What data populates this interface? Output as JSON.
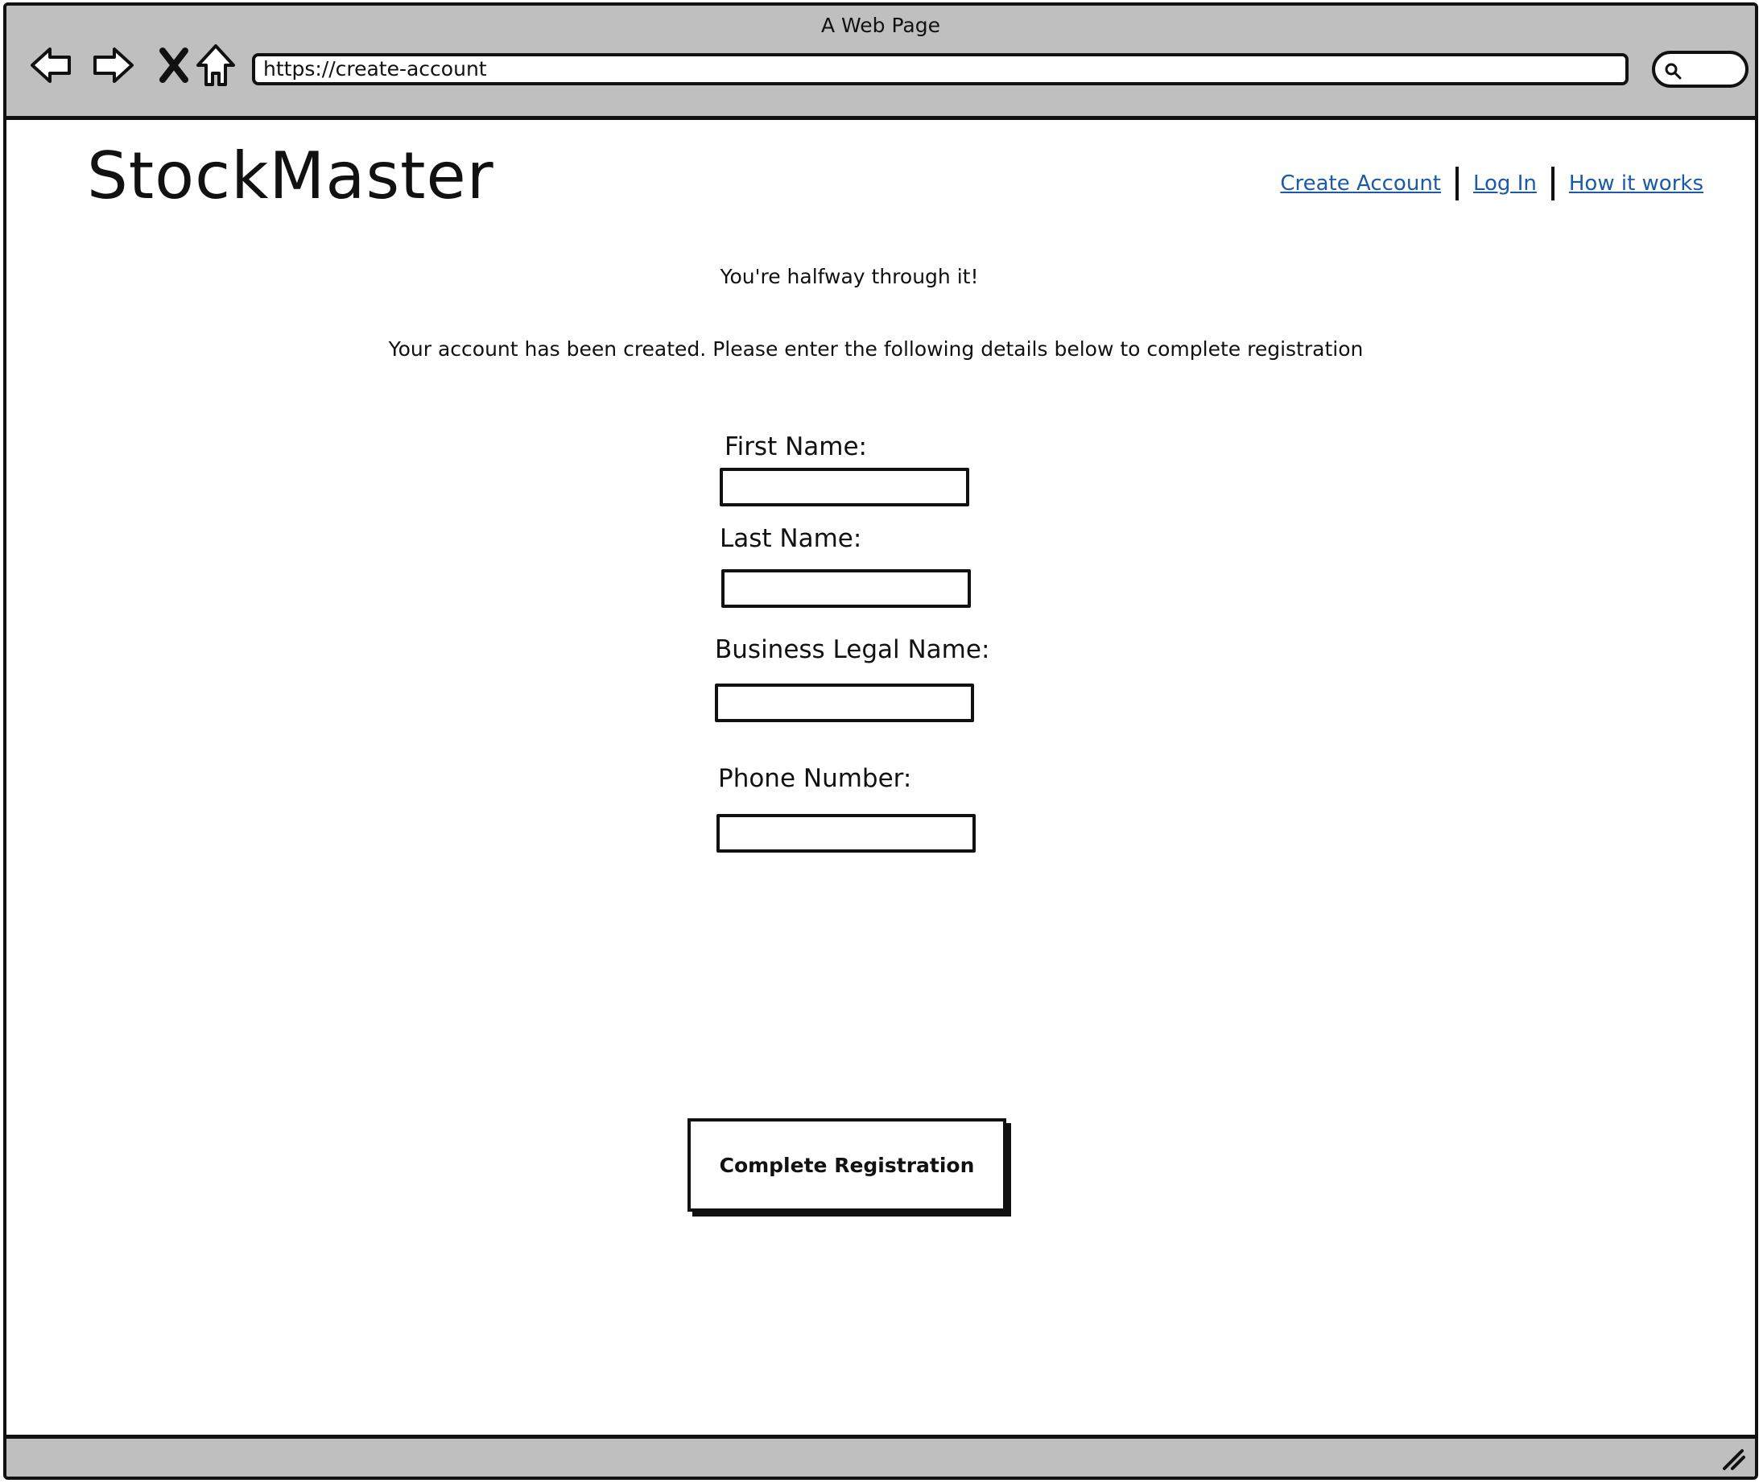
{
  "window": {
    "title": "A Web Page"
  },
  "browser": {
    "url": "https://create-account",
    "icons": [
      "back-arrow-icon",
      "forward-arrow-icon",
      "close-icon",
      "home-icon",
      "search-icon",
      "resize-grip-icon"
    ]
  },
  "header": {
    "logo": "StockMaster",
    "nav": {
      "create_account": "Create Account",
      "log_in": "Log In",
      "how_it_works": "How it works"
    },
    "link_color": "#1a5aa8"
  },
  "main": {
    "subtitle": "You're halfway through it!",
    "message": "Your account has been created. Please enter the following details below to complete registration",
    "fields": {
      "first_name": {
        "label": "First Name:",
        "value": ""
      },
      "last_name": {
        "label": "Last Name:",
        "value": ""
      },
      "business_legal_name": {
        "label": "Business Legal Name:",
        "value": ""
      },
      "phone_number": {
        "label": "Phone Number:",
        "value": ""
      }
    },
    "submit_label": "Complete Registration"
  },
  "colors": {
    "chrome": "#bfbfbf",
    "ink": "#111111",
    "background": "#ffffff"
  }
}
